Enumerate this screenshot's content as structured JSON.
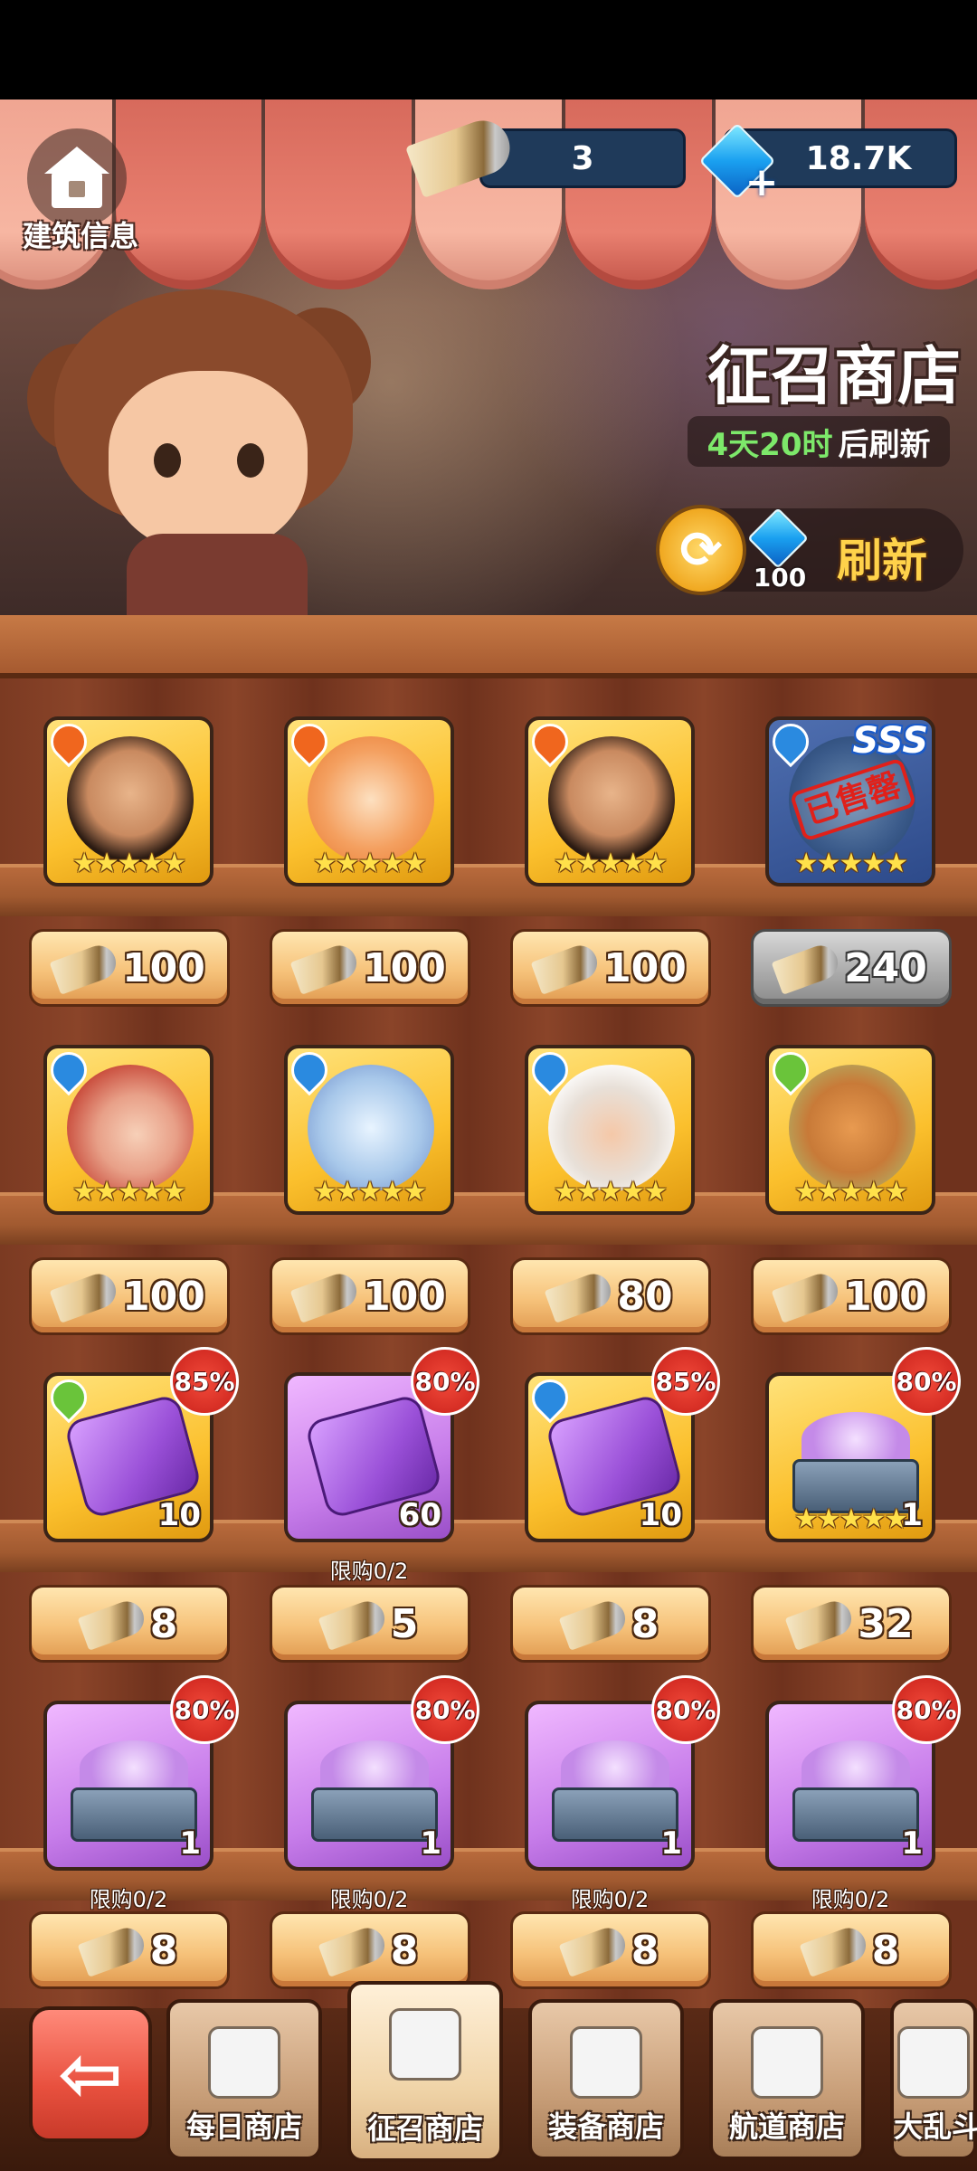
{
  "header": {
    "build_info_label": "建筑信息",
    "horn_amount": "3",
    "gem_amount": "18.7K",
    "shop_title": "征召商店",
    "refresh_time": "4天20时",
    "refresh_suffix": "后刷新",
    "refresh_cost": "100",
    "refresh_label": "刷新"
  },
  "items": [
    {
      "element": "fire",
      "portrait": "man",
      "stars": "★★★★★",
      "price": "100",
      "sold_out": false
    },
    {
      "element": "fire",
      "portrait": "sun",
      "stars": "★★★★★",
      "price": "100",
      "sold_out": false
    },
    {
      "element": "fire",
      "portrait": "man",
      "stars": "★★★★★",
      "price": "100",
      "sold_out": false
    },
    {
      "element": "water",
      "portrait": "dark",
      "stars": "★★★★★",
      "price": "240",
      "sold_out": true,
      "tier": "SSS",
      "sold_label": "已售罄"
    },
    {
      "element": "water",
      "portrait": "red",
      "stars": "★★★★★",
      "price": "100"
    },
    {
      "element": "water",
      "portrait": "ice",
      "stars": "★★★★★",
      "price": "100"
    },
    {
      "element": "water",
      "portrait": "white",
      "stars": "★★★★★",
      "price": "80"
    },
    {
      "element": "leaf",
      "portrait": "bull",
      "stars": "★★★★★",
      "price": "100"
    },
    {
      "element": "leaf",
      "kind": "gold-puzzle",
      "count": "10",
      "discount": "85%",
      "price": "8"
    },
    {
      "kind": "purple-puzzle",
      "count": "60",
      "discount": "80%",
      "limit": "限购0/2",
      "price": "5"
    },
    {
      "element": "water",
      "kind": "gold-puzzle",
      "count": "10",
      "discount": "85%",
      "price": "8"
    },
    {
      "kind": "gold-chest",
      "count": "1",
      "discount": "80%",
      "stars": "★★★★★",
      "price": "32"
    },
    {
      "kind": "purple-chest",
      "count": "1",
      "discount": "80%",
      "limit": "限购0/2",
      "price": "8"
    },
    {
      "kind": "purple-chest",
      "count": "1",
      "discount": "80%",
      "limit": "限购0/2",
      "price": "8"
    },
    {
      "kind": "purple-chest",
      "count": "1",
      "discount": "80%",
      "limit": "限购0/2",
      "price": "8"
    },
    {
      "kind": "purple-chest",
      "count": "1",
      "discount": "80%",
      "limit": "限购0/2",
      "price": "8"
    }
  ],
  "tabs": [
    {
      "label": "每日商店",
      "active": false
    },
    {
      "label": "征召商店",
      "active": true
    },
    {
      "label": "装备商店",
      "active": false
    },
    {
      "label": "航道商店",
      "active": false
    },
    {
      "label": "大乱斗",
      "active": false
    }
  ],
  "colors": {
    "awning": "#e98070",
    "shelf_wood": "#8a4429",
    "price_button": "#f6c27a",
    "gold_card": "#fbc02d",
    "purple_card": "#c77dea",
    "discount_badge": "#e0201a"
  },
  "icons": [
    "house-icon",
    "horn-icon",
    "gem-icon",
    "refresh-icon",
    "fire-element-icon",
    "water-element-icon",
    "leaf-element-icon",
    "back-arrow-icon",
    "shop-tab-icon"
  ]
}
